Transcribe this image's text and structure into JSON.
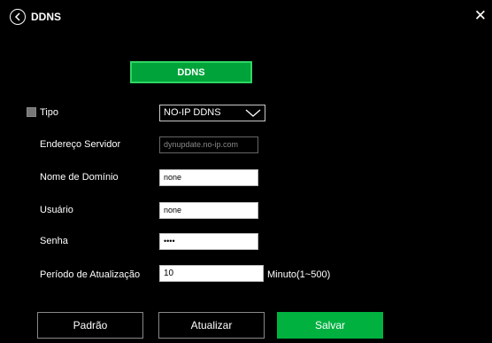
{
  "header": {
    "title": "DDNS"
  },
  "tab": {
    "label": "DDNS"
  },
  "form": {
    "tipo_label": "Tipo",
    "tipo_value": "NO-IP DDNS",
    "server_label": "Endereço Servidor",
    "server_placeholder": "dynupdate.no-ip.com",
    "domain_label": "Nome de Domínio",
    "domain_value": "none",
    "user_label": "Usuário",
    "user_value": "none",
    "password_label": "Senha",
    "password_value": "••••",
    "period_label": "Período de Atualização",
    "period_value": "10",
    "period_unit": "Minuto(1~500)"
  },
  "buttons": {
    "default": "Padrão",
    "refresh": "Atualizar",
    "save": "Salvar"
  },
  "colors": {
    "accent": "#00b140",
    "tab_border": "#2fd563",
    "background": "#000000"
  }
}
